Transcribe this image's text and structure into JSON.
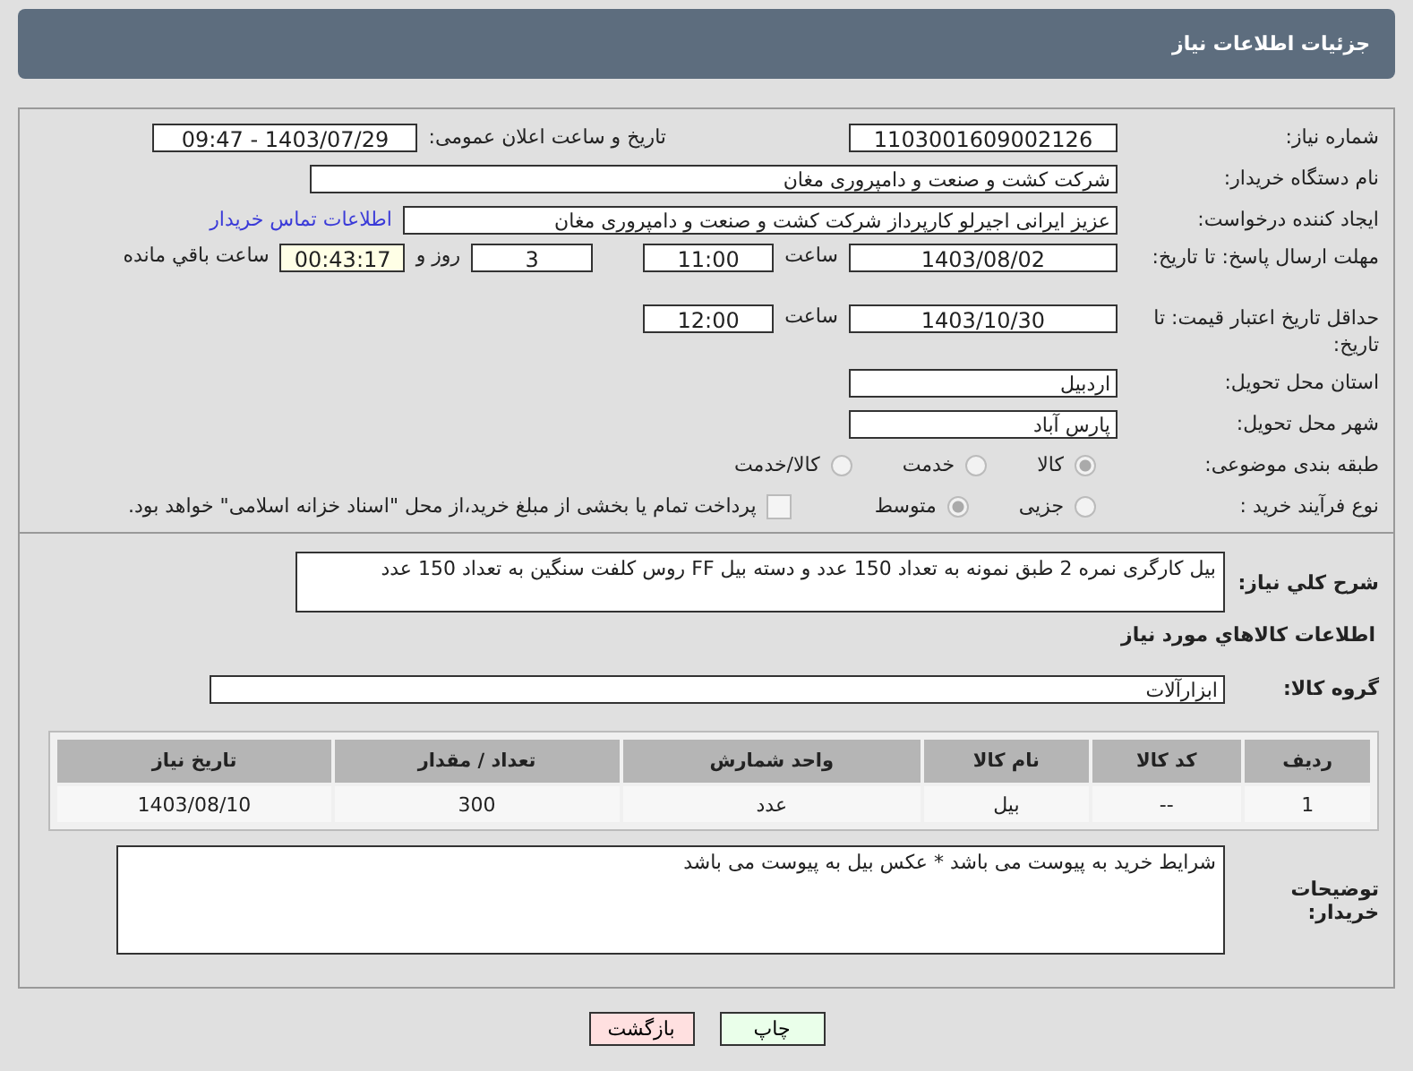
{
  "header": {
    "title": "جزئیات اطلاعات نیاز"
  },
  "need_number": {
    "label": "شماره نیاز:",
    "value": "1103001609002126"
  },
  "announce": {
    "label": "تاریخ و ساعت اعلان عمومی:",
    "value": "1403/07/29 - 09:47"
  },
  "buyer_org": {
    "label": "نام دستگاه خریدار:",
    "value": "شرکت کشت و صنعت و دامپروری مغان"
  },
  "requester": {
    "label": "ایجاد کننده درخواست:",
    "value": "عزیز ایرانی اجیرلو کارپرداز شرکت کشت و صنعت و دامپروری مغان",
    "link": "اطلاعات تماس خریدار"
  },
  "deadline": {
    "label": "مهلت ارسال پاسخ: تا تاریخ:",
    "date": "1403/08/02",
    "time_label": "ساعت",
    "time": "11:00",
    "days": "3",
    "days_label": "روز و",
    "remaining": "00:43:17",
    "remaining_label": "ساعت باقي مانده"
  },
  "validity": {
    "label": "حداقل تاریخ اعتبار قیمت: تا تاریخ:",
    "date": "1403/10/30",
    "time_label": "ساعت",
    "time": "12:00"
  },
  "province": {
    "label": "استان محل تحویل:",
    "value": "اردبیل"
  },
  "city": {
    "label": "شهر محل تحویل:",
    "value": "پارس آباد"
  },
  "category": {
    "label": "طبقه بندی موضوعی:",
    "options": [
      {
        "label": "کالا",
        "selected": true
      },
      {
        "label": "خدمت",
        "selected": false
      },
      {
        "label": "کالا/خدمت",
        "selected": false
      }
    ]
  },
  "purchase_type": {
    "label": "نوع فرآیند خرید :",
    "options": [
      {
        "label": "جزیی",
        "selected": false
      },
      {
        "label": "متوسط",
        "selected": true
      }
    ],
    "treasury": {
      "label": "پرداخت تمام یا بخشی از مبلغ خرید،از محل \"اسناد خزانه اسلامی\" خواهد بود.",
      "checked": false
    }
  },
  "description": {
    "label": "شرح کلي نياز:",
    "value": "بیل کارگری نمره 2 طبق نمونه به تعداد 150 عدد و دسته بیل FF روس کلفت سنگین به تعداد 150 عدد"
  },
  "goods_heading": "اطلاعات کالاهاي مورد نياز",
  "goods_group": {
    "label": "گروه کالا:",
    "value": "ابزارآلات"
  },
  "table": {
    "columns": [
      "ردیف",
      "کد کالا",
      "نام کالا",
      "واحد شمارش",
      "تعداد / مقدار",
      "تاریخ نیاز"
    ],
    "rows": [
      [
        "1",
        "--",
        "بیل",
        "عدد",
        "300",
        "1403/08/10"
      ]
    ]
  },
  "buyer_notes": {
    "label": "توضیحات خریدار:",
    "value": "شرایط خرید به پیوست می باشد * عکس بیل به پیوست می باشد"
  },
  "buttons": [
    {
      "label": "چاپ",
      "kind": "print"
    },
    {
      "label": "بازگشت",
      "kind": "back"
    }
  ]
}
